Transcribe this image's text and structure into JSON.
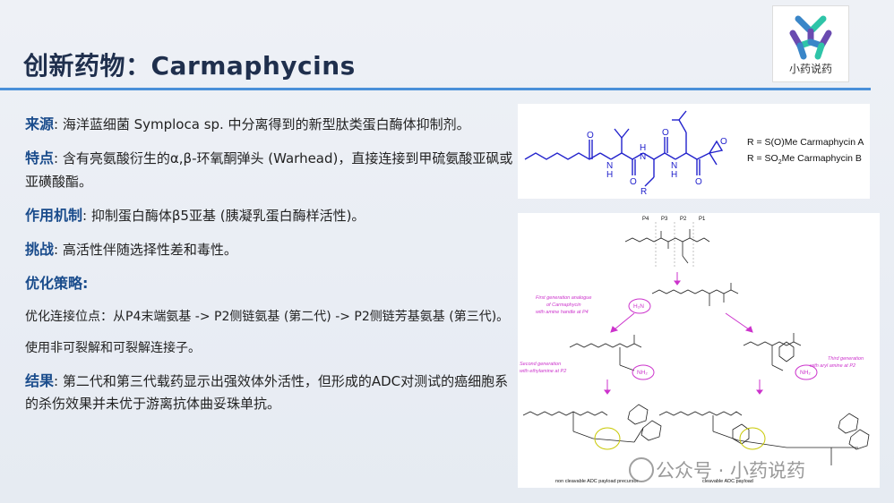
{
  "title": "创新药物：Carmaphycins",
  "logo": {
    "label": "小药说药",
    "icon": "molecule-logo-icon",
    "colors": [
      "#3a86c8",
      "#2ec4a8",
      "#6a4bb0"
    ]
  },
  "bullets": {
    "source_label": "来源",
    "source_text": ": 海洋蓝细菌 Symploca sp. 中分离得到的新型肽类蛋白酶体抑制剂。",
    "feature_label": "特点",
    "feature_text": ": 含有亮氨酸衍生的α,β-环氧酮弹头 (Warhead)，直接连接到甲硫氨酸亚砜或亚磺酸酯。",
    "mechanism_label": "作用机制",
    "mechanism_text": ": 抑制蛋白酶体β5亚基 (胰凝乳蛋白酶样活性)。",
    "challenge_label": "挑战",
    "challenge_text": ": 高活性伴随选择性差和毒性。",
    "strategy_label": "优化策略",
    "strategy_colon": ":",
    "strategy_line1": "优化连接位点：从P4末端氨基 -> P2侧链氨基 (第二代) -> P2侧链芳基氨基 (第三代)。",
    "strategy_line2": "使用非可裂解和可裂解连接子。",
    "result_label": "结果",
    "result_text": ": 第二代和第三代载药显示出强效体外活性，但形成的ADC对测试的癌细胞系的杀伤效果并未优于游离抗体曲妥珠单抗。"
  },
  "structure": {
    "r_line1": "R = S(O)Me  Carmaphycin A",
    "r_line2_pre": "R = SO",
    "r_line2_sub": "2",
    "r_line2_post": "Me   Carmaphycin B",
    "atoms": {
      "O": "O",
      "N": "N",
      "H": "H",
      "R": "R"
    }
  },
  "scheme": {
    "positions": [
      "P4",
      "P3",
      "P2",
      "P1"
    ],
    "gen1": [
      "First generation analogue",
      "of Carmaphycin",
      "with amine handle at P4"
    ],
    "gen2": [
      "Second generation",
      "with ethylamine at P2"
    ],
    "gen3": [
      "Third generation",
      "with aryl amine at P2"
    ],
    "nh2": "NH₂",
    "h2n": "H₂N",
    "label_left": "non cleavable ADC payload precursor",
    "label_right": "cleavable ADC payload"
  },
  "watermark": "公众号 · 小药说药"
}
